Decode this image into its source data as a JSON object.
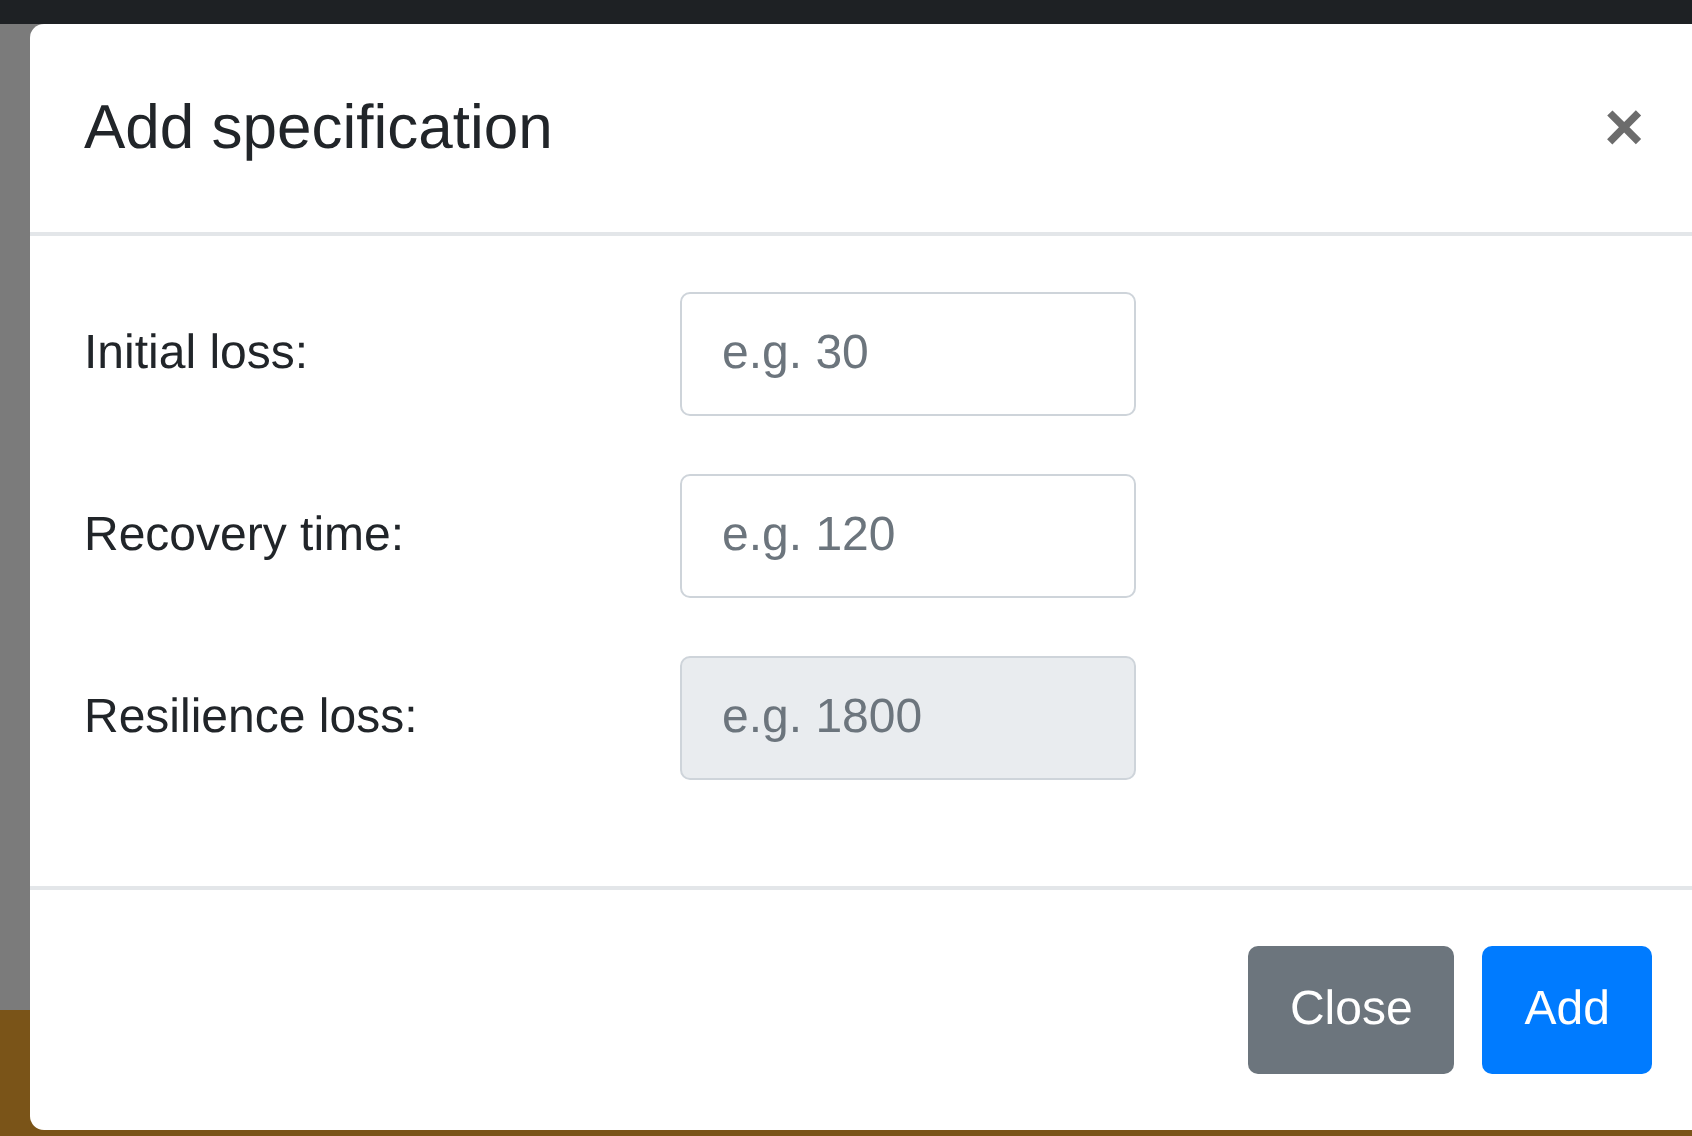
{
  "dialog": {
    "title": "Add specification",
    "close_icon": "×"
  },
  "fields": [
    {
      "label": "Initial loss:",
      "placeholder": "e.g. 30",
      "disabled": false
    },
    {
      "label": "Recovery time:",
      "placeholder": "e.g. 120",
      "disabled": false
    },
    {
      "label": "Resilience loss:",
      "placeholder": "e.g. 1800",
      "disabled": true
    }
  ],
  "buttons": [
    {
      "label": "Close",
      "kind": "secondary"
    },
    {
      "label": "Add",
      "kind": "primary"
    }
  ]
}
